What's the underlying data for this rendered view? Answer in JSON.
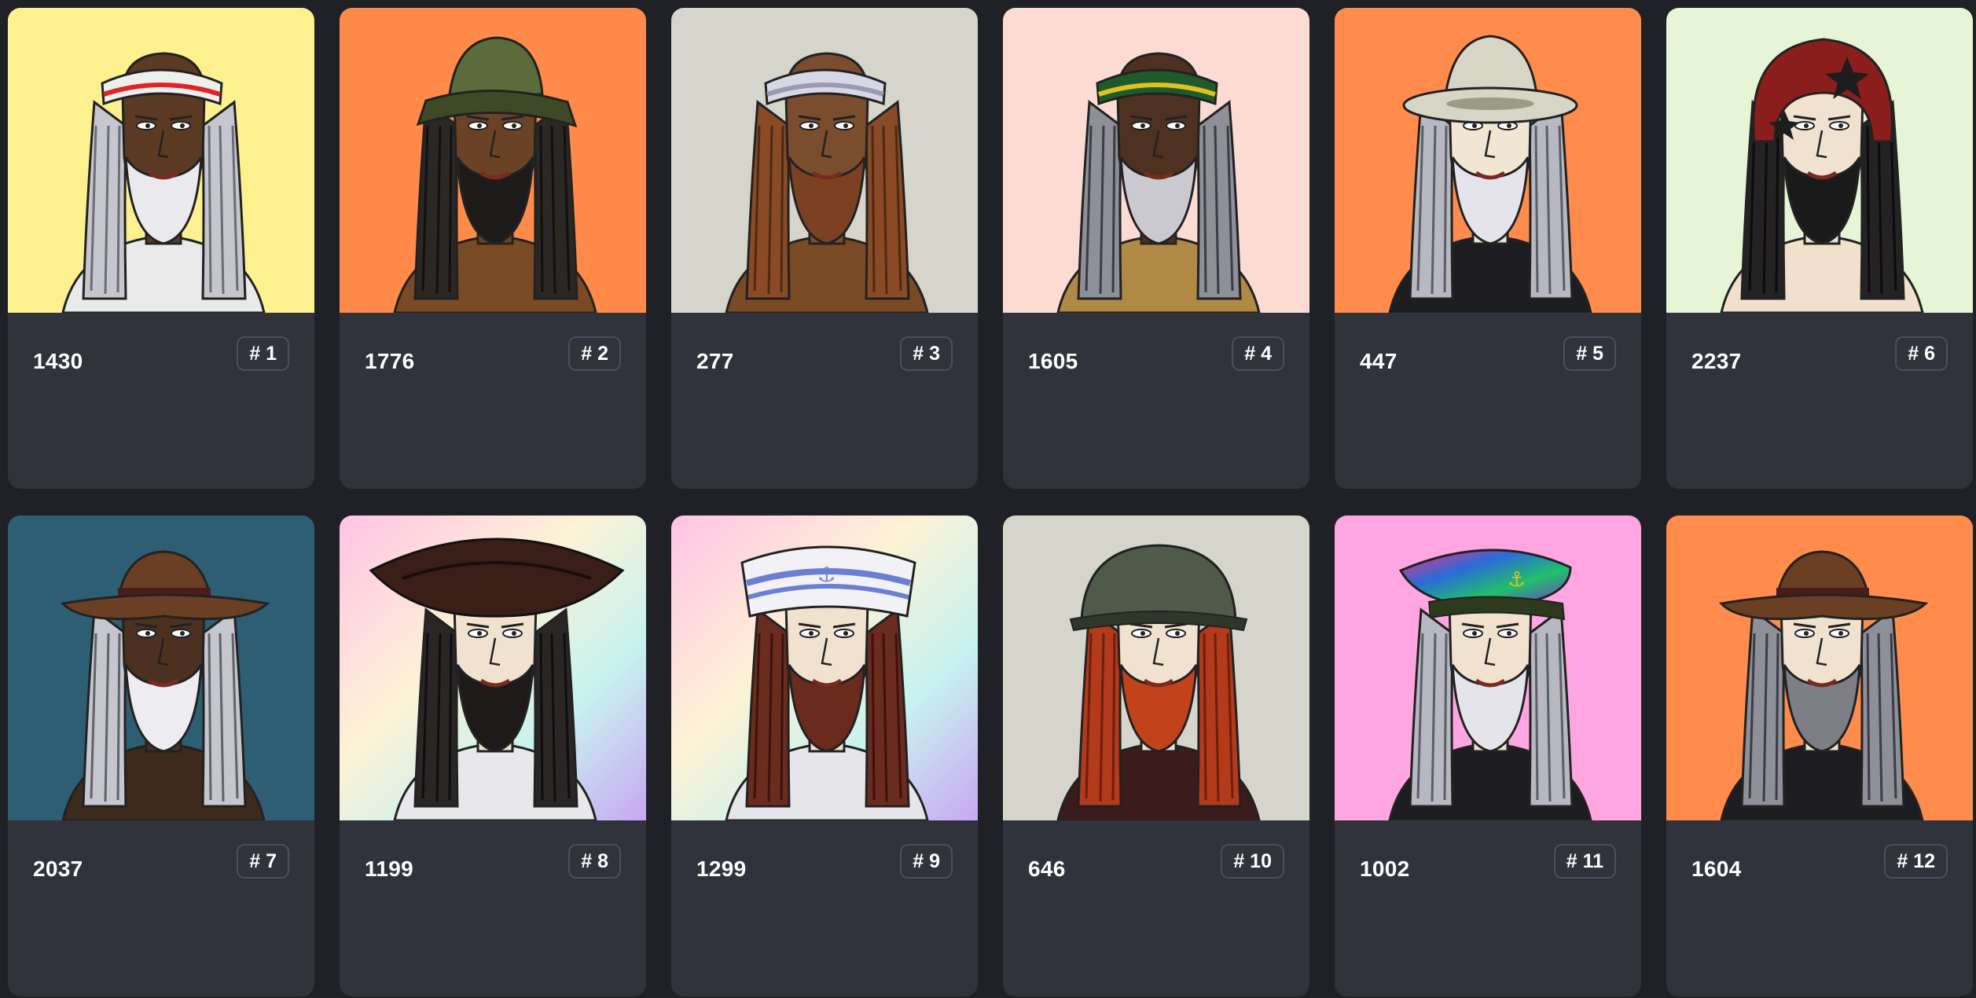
{
  "cards": [
    {
      "id": "1430",
      "rank": "# 1",
      "bg": "#fdf08f",
      "skin": "#5a3a23",
      "hair": "#c6c6cf",
      "hair_dark": "#6d6d78",
      "beard": "#e9e9ee",
      "hat": "headband",
      "hat_color": "#eeeeee",
      "accent": "#e02424",
      "shirt": "#eaeaea"
    },
    {
      "id": "1776",
      "rank": "# 2",
      "bg": "#ff8a4a",
      "skin": "#6a4327",
      "hair": "#2b2724",
      "hair_dark": "#121110",
      "beard": "#1d1b1a",
      "hat": "bucket",
      "hat_color": "#5b6b3c",
      "accent": "#3e4a27",
      "shirt": "#7a4a25"
    },
    {
      "id": "277",
      "rank": "# 3",
      "bg": "#d6d5cc",
      "skin": "#7b4d2f",
      "hair": "#8a4a26",
      "hair_dark": "#4d2a14",
      "beard": "#7c4122",
      "hat": "headband",
      "hat_color": "#d8d7e6",
      "accent": "#9b9ab0",
      "shirt": "#7a4a25"
    },
    {
      "id": "1605",
      "rank": "# 4",
      "bg": "#fcdbd3",
      "skin": "#4e3120",
      "hair": "#8e8f98",
      "hair_dark": "#3b3c44",
      "beard": "#c9c9cf",
      "hat": "headband",
      "hat_color": "#1f5b2a",
      "accent": "#e0c21e",
      "shirt": "#b08a45"
    },
    {
      "id": "447",
      "rank": "# 5",
      "bg": "#ff8c4c",
      "skin": "#f1e6d3",
      "hair": "#b8b8c2",
      "hair_dark": "#5e5e68",
      "beard": "#e4e4ea",
      "hat": "pith",
      "hat_color": "#d7d6c6",
      "accent": "#9c9b88",
      "shirt": "#1d1d21"
    },
    {
      "id": "2237",
      "rank": "# 6",
      "bg": "#e6f5d6",
      "skin": "#f1e2cf",
      "hair": "#242222",
      "hair_dark": "#0c0c0c",
      "beard": "#1b1a1a",
      "hat": "helmet",
      "hat_color": "#8b1d1d",
      "accent": "#1d1d1d",
      "shirt": "#f0e0cc"
    },
    {
      "id": "2037",
      "rank": "# 7",
      "bg": "#2e5e74",
      "skin": "#4c3020",
      "hair": "#c6c6cf",
      "hair_dark": "#62626c",
      "beard": "#ececf1",
      "hat": "fedora",
      "hat_color": "#6b3f23",
      "accent": "#4a1d1d",
      "shirt": "#3d2a1a"
    },
    {
      "id": "1199",
      "rank": "# 8",
      "bg": "#f2d6ea",
      "skin": "#f1e2cf",
      "hair": "#2a2625",
      "hair_dark": "#0f0e0e",
      "beard": "#1d1a19",
      "hat": "tricorn",
      "hat_color": "#3a1e18",
      "accent": "#1a0e0b",
      "shirt": "#e8e8ea"
    },
    {
      "id": "1299",
      "rank": "# 9",
      "bg": "#e7c4f3",
      "skin": "#f1e2cf",
      "hair": "#6b2b1e",
      "hair_dark": "#3a140c",
      "beard": "#6a2a1c",
      "hat": "sailor",
      "hat_color": "#f2f2f6",
      "accent": "#6b7fd2",
      "shirt": "#e6e6ea"
    },
    {
      "id": "646",
      "rank": "# 10",
      "bg": "#d6d5cc",
      "skin": "#f1e2cf",
      "hair": "#b33a1a",
      "hair_dark": "#6d1f0c",
      "beard": "#c2421c",
      "hat": "army",
      "hat_color": "#4f5b48",
      "accent": "#2f372b",
      "shirt": "#3b1b1b"
    },
    {
      "id": "1002",
      "rank": "# 11",
      "bg": "#ffa6e2",
      "skin": "#f1e2cf",
      "hair": "#b8b8c2",
      "hair_dark": "#5e5e68",
      "beard": "#e4e4ea",
      "hat": "captain",
      "hat_color": "#2b6bd8",
      "accent": "#20c06a",
      "shirt": "#1d1d21"
    },
    {
      "id": "1604",
      "rank": "# 12",
      "bg": "#ff8c4c",
      "skin": "#f1e2cf",
      "hair": "#8e8f98",
      "hair_dark": "#3b3c44",
      "beard": "#7d7e86",
      "hat": "fedora",
      "hat_color": "#6b3f23",
      "accent": "#4a1d1d",
      "shirt": "#1d1d21"
    }
  ]
}
